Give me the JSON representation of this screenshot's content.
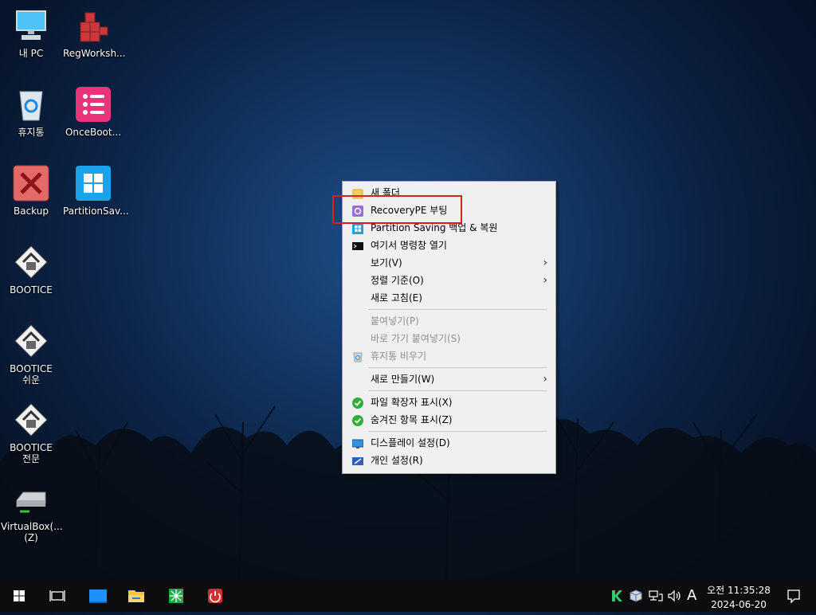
{
  "desktop": {
    "icons": [
      {
        "label": "내 PC",
        "icon": "computer-icon"
      },
      {
        "label": "RegWorksh...",
        "icon": "regworkshop-icon"
      },
      {
        "label": "휴지통",
        "icon": "recycle-bin-icon"
      },
      {
        "label": "OnceBoot...",
        "icon": "onceboot-icon"
      },
      {
        "label": "Backup",
        "icon": "backup-icon"
      },
      {
        "label": "PartitionSav...",
        "icon": "partitionsaving-icon"
      },
      {
        "label": "BOOTICE",
        "icon": "bootice-icon"
      },
      {
        "label": "BOOTICE\n쉬운",
        "icon": "bootice-icon"
      },
      {
        "label": "BOOTICE\n전문",
        "icon": "bootice-icon"
      },
      {
        "label": "VirtualBox(...\n(Z)",
        "icon": "drive-icon"
      }
    ]
  },
  "context_menu": {
    "items": [
      {
        "label": "새 폴더",
        "icon": "folder-icon"
      },
      {
        "label": "RecoveryPE 부팅",
        "icon": "recoverype-icon"
      },
      {
        "label": "Partition Saving 백업 & 복원",
        "icon": "windows-icon"
      },
      {
        "label": "여기서 명령창 열기",
        "icon": "cmd-icon"
      },
      {
        "label": "보기(V)",
        "submenu": true
      },
      {
        "label": "정렬 기준(O)",
        "submenu": true
      },
      {
        "label": "새로 고침(E)"
      },
      {
        "label": "붙여넣기(P)",
        "disabled": true
      },
      {
        "label": "바로 가기 붙여넣기(S)",
        "disabled": true
      },
      {
        "label": "휴지통 비우기",
        "icon": "recycle-bin-icon",
        "disabled": true
      },
      {
        "label": "새로 만들기(W)",
        "submenu": true
      },
      {
        "label": "파일 확장자 표시(X)",
        "icon": "check-icon"
      },
      {
        "label": "숨겨진 항목 표시(Z)",
        "icon": "check-icon"
      },
      {
        "label": "디스플레이 설정(D)",
        "icon": "display-icon"
      },
      {
        "label": "개인 설정(R)",
        "icon": "personalize-icon"
      }
    ],
    "highlighted_item": "RecoveryPE 부팅"
  },
  "taskbar": {
    "apps": [
      "start-icon",
      "task-view-icon",
      "desktop-icon",
      "file-explorer-icon",
      "network-tool-icon",
      "power-icon"
    ],
    "tray": {
      "ime": "A",
      "time": "오전 11:35:28",
      "date": "2024-06-20"
    }
  },
  "colors": {
    "highlight_border": "#e21d1d",
    "menu_bg": "#f0f0f0",
    "taskbar_bg": "#0d0d0f"
  }
}
